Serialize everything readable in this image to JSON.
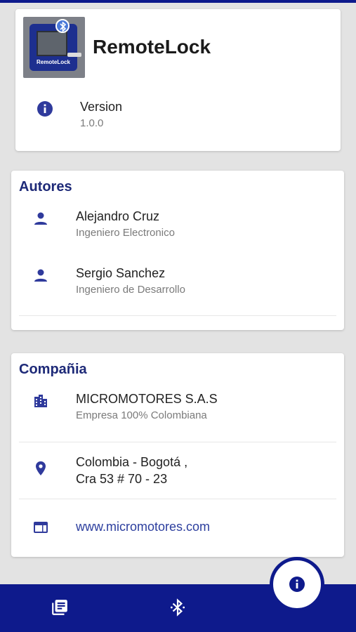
{
  "app": {
    "name": "RemoteLock",
    "logo_text": "RemoteLock",
    "version_label": "Version",
    "version_value": "1.0.0"
  },
  "authors": {
    "title": "Autores",
    "items": [
      {
        "name": "Alejandro Cruz",
        "role": "Ingeniero Electronico",
        "icon": "person-icon"
      },
      {
        "name": "Sergio Sanchez",
        "role": "Ingeniero de Desarrollo",
        "icon": "person-icon"
      }
    ]
  },
  "company": {
    "title": "Compañia",
    "name": "MICROMOTORES S.A.S",
    "tagline": "Empresa 100% Colombiana",
    "address_line1": "Colombia - Bogotá ,",
    "address_line2": "Cra 53 # 70 - 23",
    "website": "www.micromotores.com"
  },
  "bottom_nav": {
    "items": [
      {
        "icon": "library-books-icon"
      },
      {
        "icon": "bluetooth-icon"
      },
      {
        "icon": "info-icon",
        "active": true
      }
    ]
  },
  "colors": {
    "accent": "#0e1a8c",
    "icon": "#2f3a9c",
    "section_title": "#1e2a78"
  }
}
